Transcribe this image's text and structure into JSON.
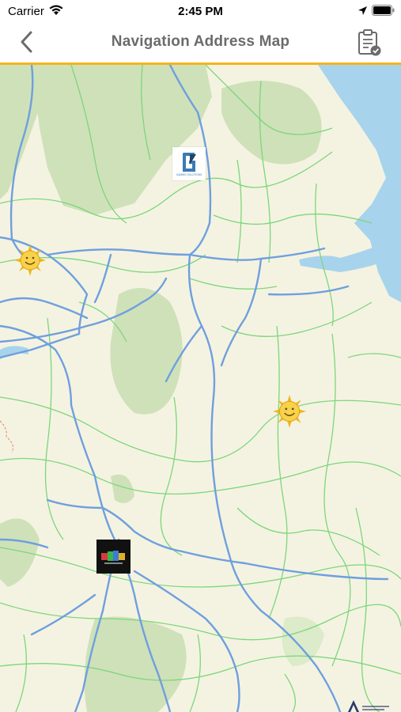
{
  "status_bar": {
    "carrier": "Carrier",
    "time": "2:45 PM",
    "wifi_icon": "wifi-icon",
    "location_icon": "location-arrow-icon",
    "battery_icon": "battery-icon"
  },
  "nav": {
    "title": "Navigation Address Map",
    "back_icon": "chevron-left-icon",
    "clipboard_icon": "clipboard-check-icon",
    "accent_color": "#f2b51d",
    "title_color": "#6b6b6b"
  },
  "map": {
    "background_color": "#f4f3e1",
    "water_color": "#a8d3ec",
    "forest_color": "#cfe1b9",
    "motorway_color": "#6f9fde",
    "road_color": "#7cd67c",
    "markers": [
      {
        "name": "gaming-solutions-logo",
        "label": "GAMING SOLUTIONS"
      },
      {
        "name": "sun-logo-marker-west"
      },
      {
        "name": "sun-logo-marker-east"
      },
      {
        "name": "dark-logo-marker"
      }
    ]
  }
}
